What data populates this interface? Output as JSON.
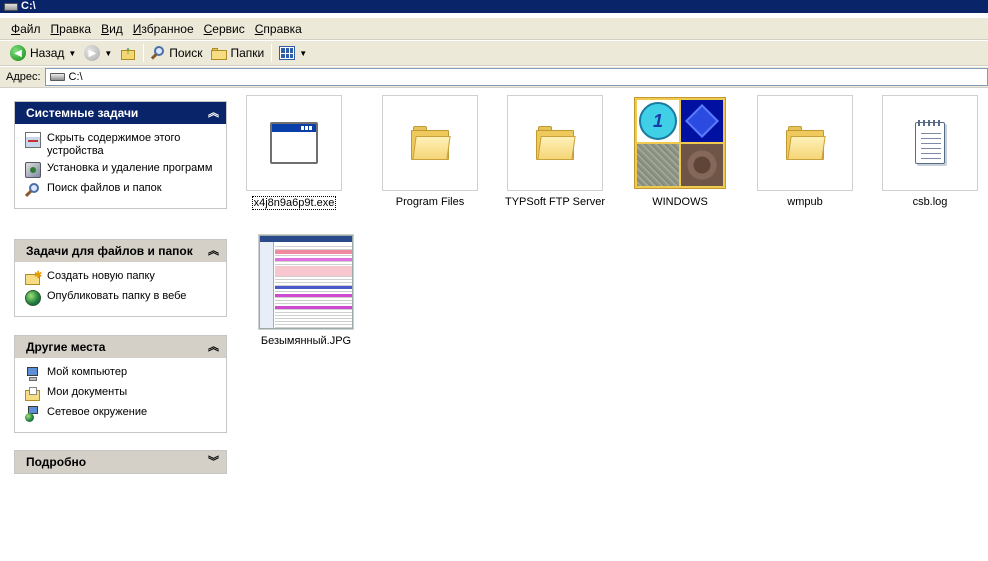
{
  "window": {
    "title": "C:\\"
  },
  "menu": [
    {
      "key": "Ф",
      "rest": "айл"
    },
    {
      "key": "П",
      "rest": "равка"
    },
    {
      "key": "В",
      "rest": "ид"
    },
    {
      "key": "И",
      "rest": "збранное"
    },
    {
      "key": "С",
      "rest": "ервис"
    },
    {
      "key": "С",
      "rest": "правка"
    }
  ],
  "toolbar": {
    "back_label": "Назад",
    "search_label": "Поиск",
    "folders_label": "Папки"
  },
  "address": {
    "label": "Адрес:",
    "value": "C:\\"
  },
  "panels": {
    "system": {
      "title": "Системные задачи",
      "items": [
        "Скрыть содержимое этого устройства",
        "Установка и удаление программ",
        "Поиск файлов и папок"
      ]
    },
    "files": {
      "title": "Задачи для файлов и папок",
      "items": [
        "Создать новую папку",
        "Опубликовать папку в вебе"
      ]
    },
    "places": {
      "title": "Другие места",
      "items": [
        "Мой компьютер",
        "Мои документы",
        "Сетевое окружение"
      ]
    },
    "details": {
      "title": "Подробно"
    }
  },
  "files": [
    {
      "name": "x4j8n9a6p9t.exe",
      "type": "exe"
    },
    {
      "name": "Program Files",
      "type": "folder"
    },
    {
      "name": "TYPSoft FTP Server",
      "type": "folder"
    },
    {
      "name": "WINDOWS",
      "type": "windows-folder"
    },
    {
      "name": "wmpub",
      "type": "folder"
    },
    {
      "name": "csb.log",
      "type": "log"
    },
    {
      "name": "Безымянный.JPG",
      "type": "jpg"
    }
  ],
  "colors": {
    "titlebar": "#0a246a",
    "chrome": "#ece9d8",
    "panel_header_active": "#0a246a",
    "panel_header_inactive": "#d4d0c8"
  }
}
